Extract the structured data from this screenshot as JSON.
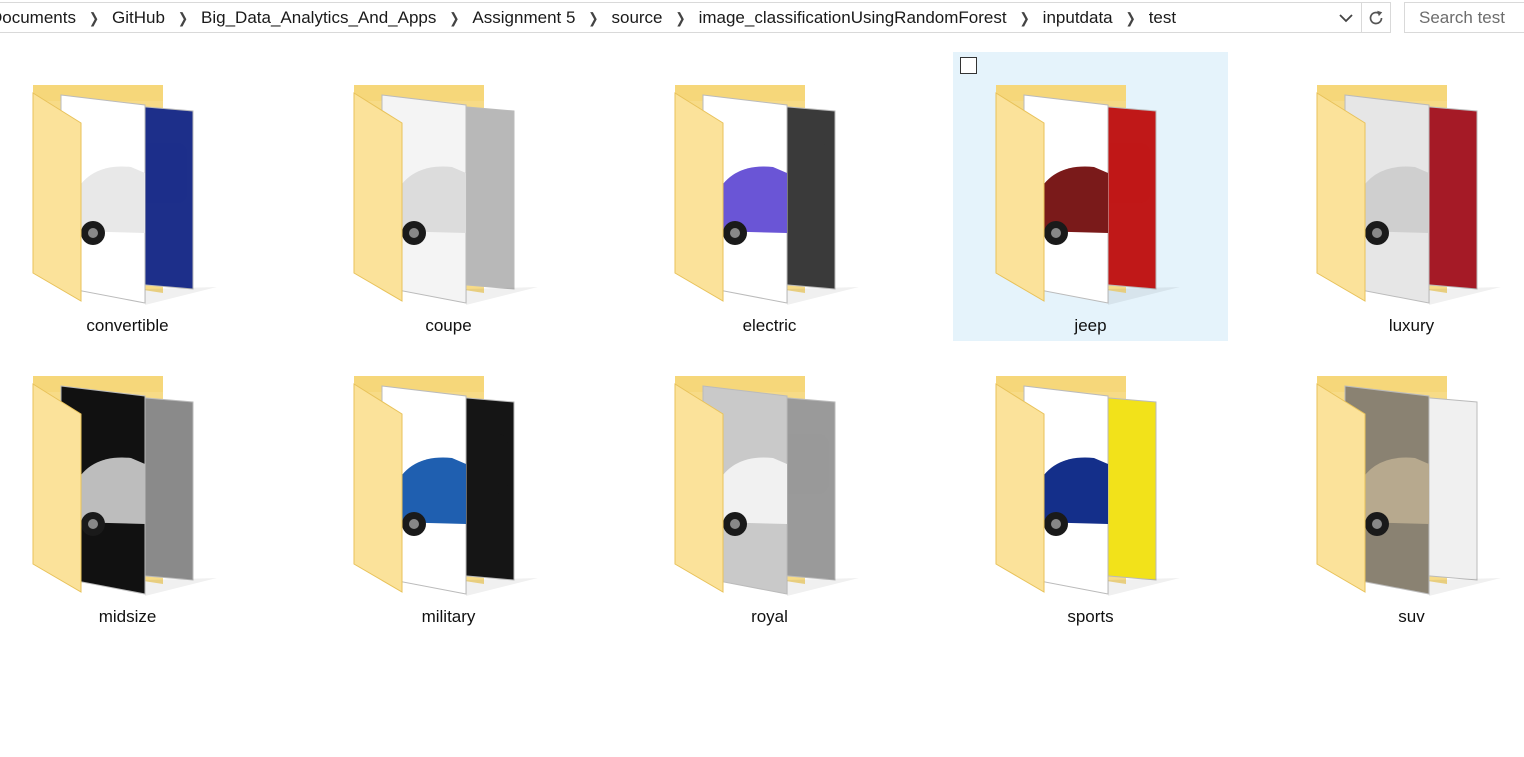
{
  "address_bar": {
    "crumbs": [
      "Documents",
      "GitHub",
      "Big_Data_Analytics_And_Apps",
      "Assignment 5",
      "source",
      "image_classificationUsingRandomForest",
      "inputdata",
      "test"
    ],
    "dropdown_icon": "chevron-down-icon",
    "refresh_icon": "refresh-icon"
  },
  "search": {
    "placeholder": "Search test",
    "value": ""
  },
  "folders": [
    {
      "name": "convertible",
      "selected": false,
      "front": "#ffffff",
      "front_car": "#e8e8e8",
      "back": "#1d2f8a"
    },
    {
      "name": "coupe",
      "selected": false,
      "front": "#f4f4f4",
      "front_car": "#dcdcdc",
      "back": "#b8b8b8"
    },
    {
      "name": "electric",
      "selected": false,
      "front": "#ffffff",
      "front_car": "#6a55d6",
      "back": "#3a3a3a"
    },
    {
      "name": "jeep",
      "selected": true,
      "front": "#ffffff",
      "front_car": "#7a1a1a",
      "back": "#c01818"
    },
    {
      "name": "luxury",
      "selected": false,
      "front": "#e6e6e6",
      "front_car": "#cfcfcf",
      "back": "#a51a26"
    },
    {
      "name": "midsize",
      "selected": false,
      "front": "#111111",
      "front_car": "#bdbdbd",
      "back": "#8a8a8a"
    },
    {
      "name": "military",
      "selected": false,
      "front": "#ffffff",
      "front_car": "#1f5fb0",
      "back": "#151515"
    },
    {
      "name": "royal",
      "selected": false,
      "front": "#c9c9c9",
      "front_car": "#f1f1f1",
      "back": "#9a9a9a"
    },
    {
      "name": "sports",
      "selected": false,
      "front": "#ffffff",
      "front_car": "#142f8a",
      "back": "#f2e21a"
    },
    {
      "name": "suv",
      "selected": false,
      "front": "#8a8272",
      "front_car": "#b7a98e",
      "back": "#f0f0f0"
    }
  ],
  "colors": {
    "selection": "#e5f3fb",
    "folder_tab": "#f6d77a",
    "folder_front": "#fbe29a",
    "folder_edge": "#e8c25a"
  }
}
